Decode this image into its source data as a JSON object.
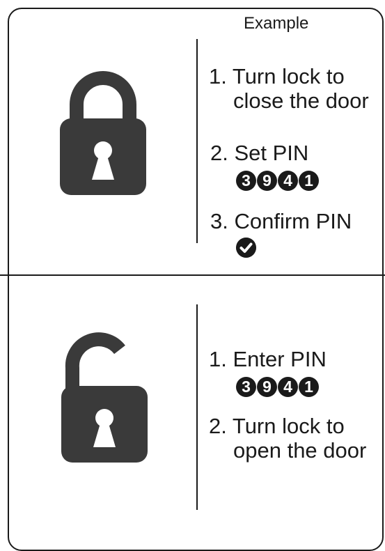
{
  "example_label": "Example",
  "lock_section": {
    "icon": "closed-padlock-icon",
    "steps": [
      {
        "line1": "1. Turn lock to",
        "line2": "close the door"
      },
      {
        "line1": "2. Set PIN"
      },
      {
        "line1": "3. Confirm PIN"
      }
    ],
    "pin_digits": [
      "3",
      "9",
      "4",
      "1"
    ],
    "confirm_icon": "checkmark-icon"
  },
  "unlock_section": {
    "icon": "open-padlock-icon",
    "steps": [
      {
        "line1": "1. Enter PIN"
      },
      {
        "line1": "2. Turn lock to",
        "line2": "open the door"
      }
    ],
    "pin_digits": [
      "3",
      "9",
      "4",
      "1"
    ]
  }
}
